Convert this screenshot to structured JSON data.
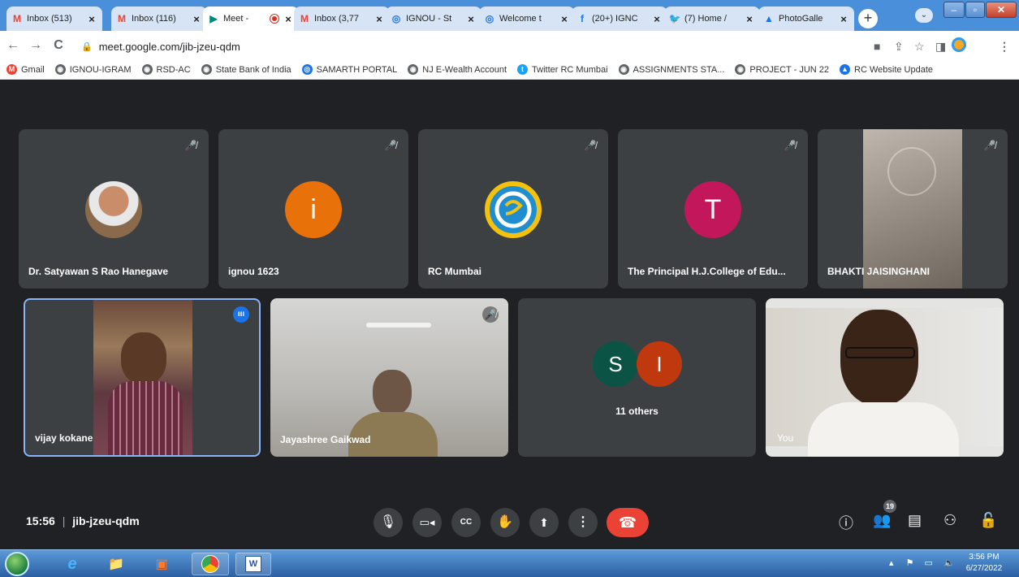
{
  "tabs": [
    {
      "title": "Inbox (513)",
      "icon": "gmail-icon",
      "active": false
    },
    {
      "title": "Inbox (116)",
      "icon": "gmail-icon",
      "active": false
    },
    {
      "title": "Meet -",
      "icon": "meet-icon",
      "active": true
    },
    {
      "title": "Inbox (3,77",
      "icon": "gmail-icon",
      "active": false
    },
    {
      "title": "IGNOU - St",
      "icon": "ignou-icon",
      "active": false
    },
    {
      "title": "Welcome t",
      "icon": "ignou-icon",
      "active": false
    },
    {
      "title": "(20+) IGNC",
      "icon": "facebook-icon",
      "active": false
    },
    {
      "title": "(7) Home /",
      "icon": "twitter-icon",
      "active": false
    },
    {
      "title": "PhotoGalle",
      "icon": "photogallery-icon",
      "active": false
    }
  ],
  "address": {
    "url": "meet.google.com/jib-jzeu-qdm"
  },
  "bookmarks": [
    {
      "label": "Gmail",
      "icon": "gmail-icon",
      "color": "#ea4335"
    },
    {
      "label": "IGNOU-IGRAM",
      "icon": "globe-icon",
      "color": "#5f6368"
    },
    {
      "label": "RSD-AC",
      "icon": "globe-icon",
      "color": "#5f6368"
    },
    {
      "label": "State Bank of India",
      "icon": "globe-icon",
      "color": "#5f6368"
    },
    {
      "label": "SAMARTH PORTAL",
      "icon": "ignou-icon",
      "color": "#1a73e8"
    },
    {
      "label": "NJ E-Wealth Account",
      "icon": "globe-icon",
      "color": "#5f6368"
    },
    {
      "label": "Twitter RC Mumbai",
      "icon": "twitter-icon",
      "color": "#1da1f2"
    },
    {
      "label": "ASSIGNMENTS STA...",
      "icon": "globe-icon",
      "color": "#5f6368"
    },
    {
      "label": "PROJECT - JUN 22",
      "icon": "globe-icon",
      "color": "#5f6368"
    },
    {
      "label": "RC Website Update",
      "icon": "photogallery-icon",
      "color": "#1a73e8"
    }
  ],
  "participants": [
    {
      "name": "Dr. Satyawan S Rao Hanegave",
      "muted": true,
      "avatar_type": "photo"
    },
    {
      "name": "ignou 1623",
      "muted": true,
      "avatar_letter": "i",
      "avatar_color": "#e8710a"
    },
    {
      "name": "RC Mumbai",
      "muted": true,
      "avatar_type": "ignou-logo"
    },
    {
      "name": "The Principal H.J.College of Edu...",
      "muted": true,
      "avatar_letter": "T",
      "avatar_color": "#c2185b"
    },
    {
      "name": "BHAKTI JAISINGHANI",
      "muted": true,
      "avatar_type": "video"
    },
    {
      "name": "vijay kokane",
      "muted": false,
      "speaking": true,
      "avatar_type": "video"
    },
    {
      "name": "Jayashree Gaikwad",
      "muted": true,
      "avatar_type": "video"
    },
    {
      "name": "You",
      "muted": false,
      "avatar_type": "video"
    }
  ],
  "others_tile": {
    "label": "11 others",
    "avatars": [
      {
        "letter": "S",
        "color": "#0b5345"
      },
      {
        "letter": "I",
        "color": "#c0380e"
      }
    ]
  },
  "meet": {
    "time": "15:56",
    "separator": "|",
    "meeting_code": "jib-jzeu-qdm",
    "participant_count": "19"
  },
  "taskbar": {
    "time": "3:56 PM",
    "date": "6/27/2022"
  }
}
